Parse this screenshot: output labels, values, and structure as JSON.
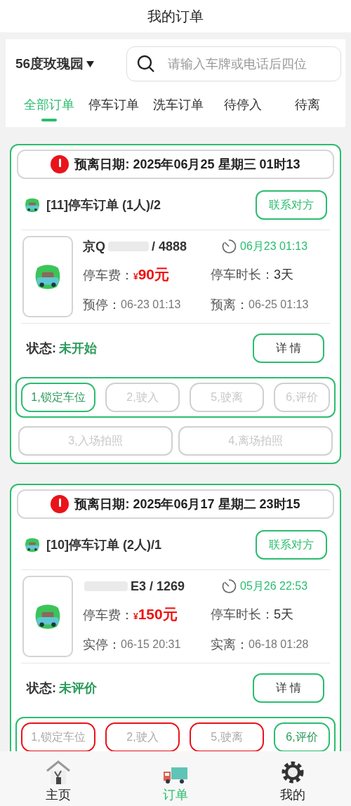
{
  "title": "我的订单",
  "location": {
    "name": "56度玫瑰园"
  },
  "search": {
    "placeholder": "请输入车牌或电话后四位"
  },
  "tabs": [
    {
      "label": "全部订单",
      "selected": true
    },
    {
      "label": "停车订单",
      "selected": false
    },
    {
      "label": "洗车订单",
      "selected": false
    },
    {
      "label": "待停入",
      "selected": false
    },
    {
      "label": "待离",
      "selected": false
    }
  ],
  "orders": [
    {
      "alert": "预离日期: 2025年06月25 星期三 01时13",
      "heading": "[11]停车订单 (1人)/2",
      "contact": "联系对方",
      "plate_start": "京Q",
      "plate_end": "/ 4888",
      "time": "06月23 01:13",
      "fee_label": "停车费：",
      "fee_currency": "¥",
      "fee": "90元",
      "duration_label": "停车时长：",
      "duration": "3天",
      "start_label": "预停：",
      "start": "06-23 01:13",
      "end_label": "预离：",
      "end": "06-25 01:13",
      "status_label": "状态:",
      "status": "未开始",
      "detail": "详 情",
      "steps": [
        {
          "label": "1,锁定车位",
          "active": true,
          "overdue": false
        },
        {
          "label": "2,驶入",
          "active": false,
          "overdue": false
        },
        {
          "label": "5,驶离",
          "active": false,
          "overdue": false
        },
        {
          "label": "6,评价",
          "active": false,
          "overdue": false
        }
      ],
      "photos": [
        {
          "label": "3,入场拍照"
        },
        {
          "label": "4,离场拍照"
        }
      ]
    },
    {
      "alert": "预离日期: 2025年06月17 星期二 23时15",
      "heading": "[10]停车订单 (2人)/1",
      "contact": "联系对方",
      "plate_end": "E3 / 1269",
      "time": "05月26 22:53",
      "fee_label": "停车费：",
      "fee_currency": "¥",
      "fee": "150元",
      "duration_label": "停车时长：",
      "duration": "5天",
      "start_label": "实停：",
      "start": "06-15 20:31",
      "end_label": "实离：",
      "end": "06-18 01:28",
      "status_label": "状态:",
      "status": "未评价",
      "detail": "详 情",
      "steps": [
        {
          "label": "1,锁定车位",
          "active": false,
          "overdue": true
        },
        {
          "label": "2,驶入",
          "active": false,
          "overdue": true
        },
        {
          "label": "5,驶离",
          "active": false,
          "overdue": true
        },
        {
          "label": "6,评价",
          "active": true,
          "overdue": false
        }
      ]
    }
  ],
  "nav": [
    {
      "label": "主页",
      "kind": "home",
      "selected": false
    },
    {
      "label": "订单",
      "kind": "orders",
      "selected": true
    },
    {
      "label": "我的",
      "kind": "mine",
      "selected": false
    }
  ]
}
